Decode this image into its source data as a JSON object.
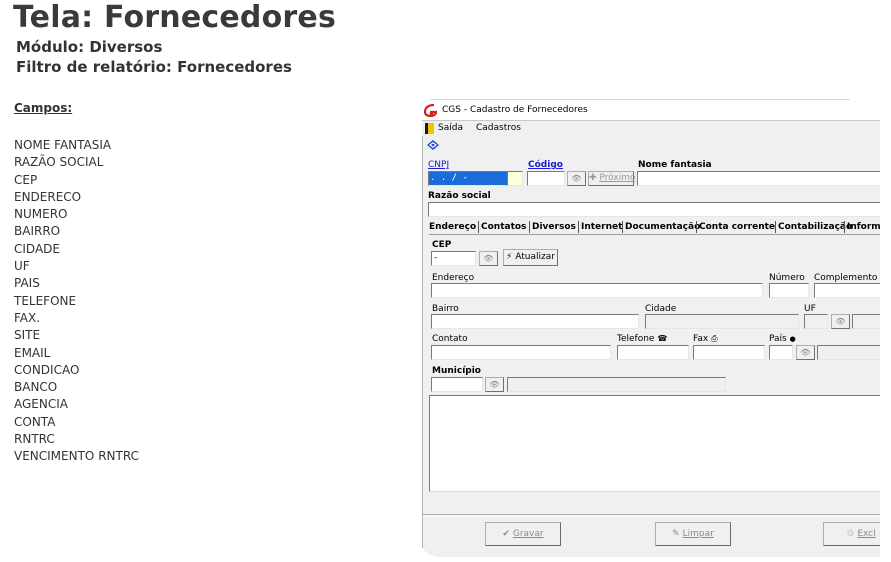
{
  "doc": {
    "title": "Tela: Fornecedores",
    "module": "Módulo: Diversos",
    "report_filter": "Filtro de relatório: Fornecedores",
    "fields_title": "Campos:",
    "fields": [
      "NOME FANTASIA",
      "RAZÃO SOCIAL",
      "CEP",
      "ENDERECO",
      "NUMERO",
      "BAIRRO",
      "CIDADE",
      "UF",
      "PAIS",
      "TELEFONE",
      "FAX.",
      "SITE",
      "EMAIL",
      "CONDICAO",
      "BANCO",
      "AGENCIA",
      "CONTA",
      "RNTRC",
      "VENCIMENTO RNTRC"
    ]
  },
  "window": {
    "title": "CGS - Cadastro de Fornecedores",
    "menu": {
      "exit": "Saída",
      "cadastros": "Cadastros"
    },
    "cnpj_label": "CNPJ",
    "cnpj_value": "  .   .   /    -  ",
    "codigo_label": "Código",
    "proximo_label": "Próximo",
    "nome_fantasia_label": "Nome fantasia",
    "razao_social_label": "Razão social",
    "tabs": [
      "Endereço",
      "Contatos",
      "Diversos",
      "Internet",
      "Documentação",
      "Conta corrente",
      "Contabilização",
      "Informa"
    ],
    "cep_label": "CEP",
    "cep_value": "     -   ",
    "atualizar_label": "Atualizar",
    "endereco_label": "Endereço",
    "numero_label": "Número",
    "complemento_label": "Complemento",
    "bairro_label": "Bairro",
    "cidade_label": "Cidade",
    "uf_label": "UF",
    "contato_label": "Contato",
    "telefone_label": "Telefone",
    "fax_label": "Fax",
    "pais_label": "País",
    "municipio_label": "Município",
    "footer": {
      "gravar": "Gravar",
      "limpar": "Limpar",
      "excluir": "Excl"
    }
  },
  "colors": {
    "accent_blue": "#1b1bd1",
    "selection": "#1a6cd8",
    "window_bg": "#f0f0f0"
  }
}
